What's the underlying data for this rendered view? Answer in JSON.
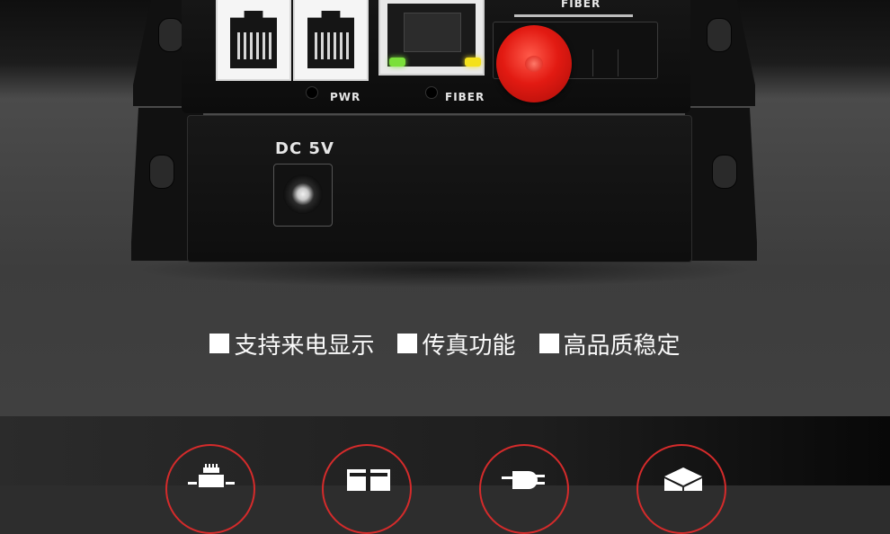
{
  "device": {
    "labels": {
      "fiber_top": "FIBER",
      "pwr": "PWR",
      "fiber": "FIBER",
      "dc": "DC 5V"
    }
  },
  "features": [
    {
      "label": "支持来电显示"
    },
    {
      "label": "传真功能"
    },
    {
      "label": "高品质稳定"
    }
  ],
  "icons": [
    {
      "name": "network-device-icon"
    },
    {
      "name": "box-icon"
    },
    {
      "name": "plug-icon"
    },
    {
      "name": "cube-icon"
    }
  ],
  "colors": {
    "accent_ring": "#d52b2b",
    "fiber_cap": "#e21a12",
    "led_green": "#7be03a",
    "led_yellow": "#f4e11a"
  }
}
